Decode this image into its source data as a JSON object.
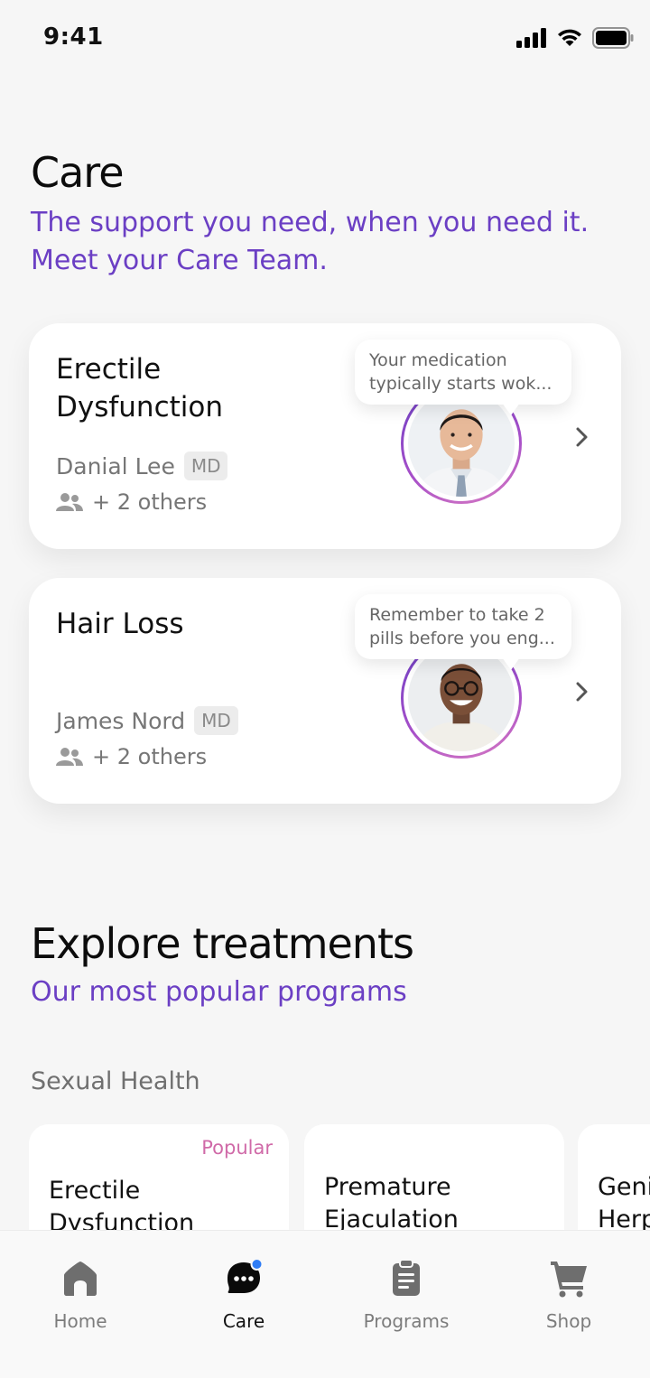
{
  "status": {
    "time": "9:41"
  },
  "care": {
    "title": "Care",
    "subtitle_line1": "The support you need, when you need it.",
    "subtitle_line2": "Meet your Care Team.",
    "cards": [
      {
        "condition_line1": "Erectile",
        "condition_line2": "Dysfunction",
        "doctor": "Danial Lee",
        "badge": "MD",
        "others": "+ 2 others",
        "message_line1": "Your medication",
        "message_line2": "typically starts wok..."
      },
      {
        "condition_line1": "Hair Loss",
        "condition_line2": "",
        "doctor": "James Nord",
        "badge": "MD",
        "others": "+ 2 others",
        "message_line1": "Remember to take 2",
        "message_line2": "pills before you eng..."
      }
    ]
  },
  "explore": {
    "title": "Explore treatments",
    "subtitle": "Our most popular programs",
    "category": "Sexual Health",
    "cards": [
      {
        "badge": "Popular",
        "line1": "Erectile",
        "line2": "Dysfunction"
      },
      {
        "badge": "",
        "line1": "Premature",
        "line2": "Ejaculation"
      },
      {
        "badge": "",
        "line1": "Geni",
        "line2": "Herp"
      }
    ]
  },
  "tabs": [
    {
      "label": "Home",
      "icon": "home-icon"
    },
    {
      "label": "Care",
      "icon": "chat-icon"
    },
    {
      "label": "Programs",
      "icon": "clipboard-icon"
    },
    {
      "label": "Shop",
      "icon": "cart-icon"
    }
  ],
  "colors": {
    "accent": "#6b3fc4",
    "popular": "#d06aa8",
    "notification": "#2f7df6"
  }
}
